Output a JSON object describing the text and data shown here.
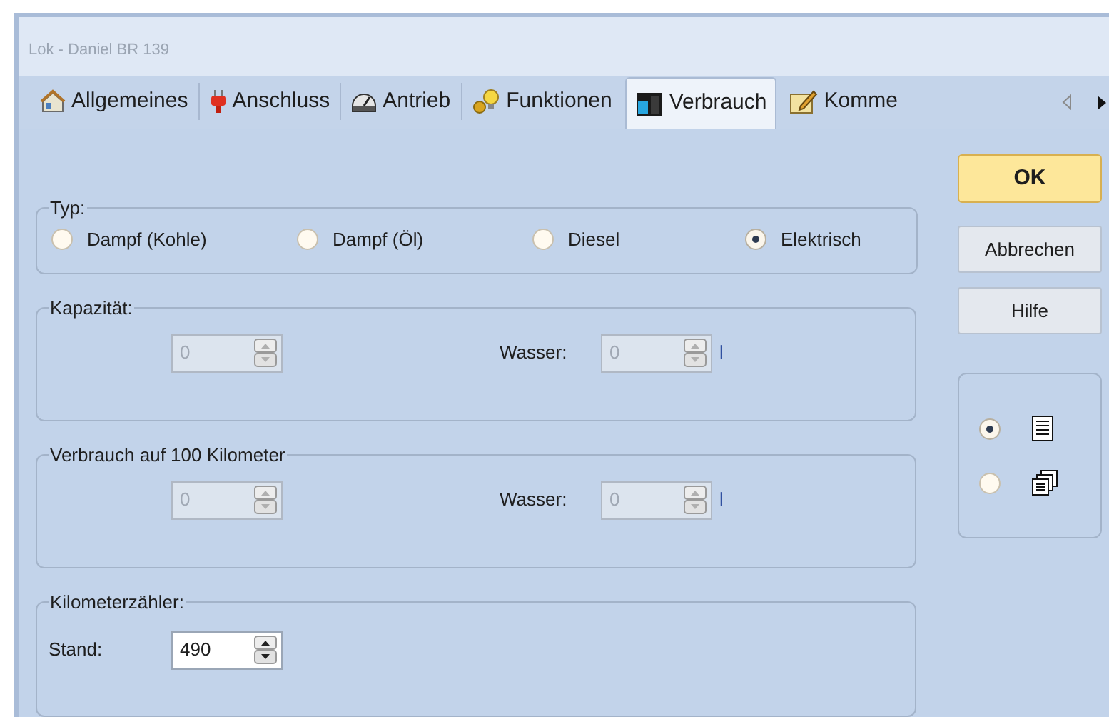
{
  "window": {
    "title": "Lok - Daniel BR 139"
  },
  "tabs": [
    {
      "label": "Allgemeines",
      "selected": false
    },
    {
      "label": "Anschluss",
      "selected": false
    },
    {
      "label": "Antrieb",
      "selected": false
    },
    {
      "label": "Funktionen",
      "selected": false
    },
    {
      "label": "Verbrauch",
      "selected": true
    },
    {
      "label": "Komme",
      "selected": false
    }
  ],
  "typ": {
    "title": "Typ:",
    "options": [
      {
        "label": "Dampf (Kohle)",
        "selected": false
      },
      {
        "label": "Dampf (Öl)",
        "selected": false
      },
      {
        "label": "Diesel",
        "selected": false
      },
      {
        "label": "Elektrisch",
        "selected": true
      }
    ]
  },
  "kapazitaet": {
    "title": "Kapazität:",
    "value": "0",
    "disabled": true,
    "wasser_label": "Wasser:",
    "wasser_value": "0",
    "wasser_disabled": true,
    "unit": "l"
  },
  "verbrauch": {
    "title": "Verbrauch auf 100 Kilometer",
    "value": "0",
    "disabled": true,
    "wasser_label": "Wasser:",
    "wasser_value": "0",
    "wasser_disabled": true,
    "unit": "l"
  },
  "kilometerzaehler": {
    "title": "Kilometerzähler:",
    "label": "Stand:",
    "value": "490",
    "disabled": false
  },
  "buttons": [
    {
      "label": "OK",
      "default": true
    },
    {
      "label": "Abbrechen",
      "default": false
    },
    {
      "label": "Hilfe",
      "default": false
    }
  ],
  "view_options": [
    {
      "kind": "list",
      "selected": true
    },
    {
      "kind": "pages",
      "selected": false
    }
  ]
}
